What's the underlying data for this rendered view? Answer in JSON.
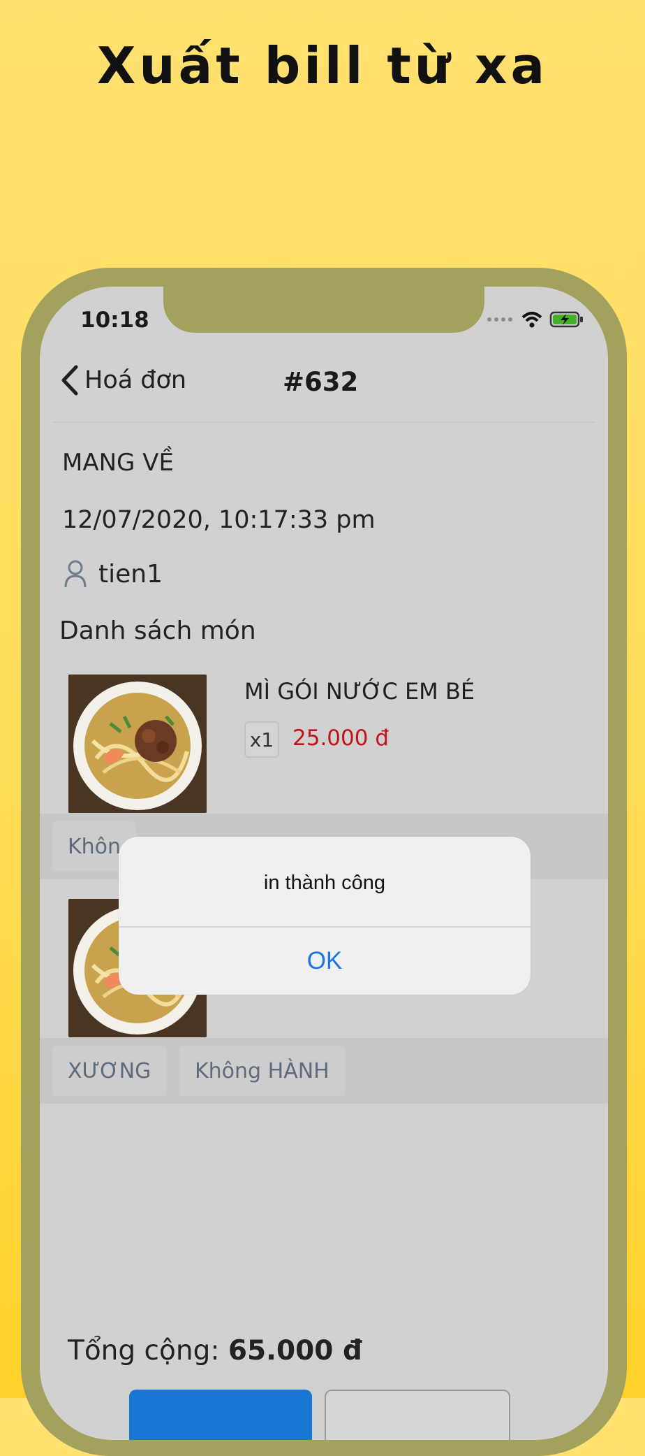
{
  "headline": "Xuất bill từ xa",
  "status_bar": {
    "time": "10:18"
  },
  "navbar": {
    "back_label": "Hoá đơn",
    "order_no": "#632"
  },
  "order": {
    "type": "MANG VỀ",
    "datetime": "12/07/2020, 10:17:33 pm",
    "staff": "tien1"
  },
  "section_title": "Danh sách món",
  "items": [
    {
      "name": "MÌ GÓI NƯỚC EM BÉ",
      "qty": "x1",
      "price": "25.000 đ",
      "tags": [
        "Khôn"
      ]
    },
    {
      "tags": [
        "XƯƠNG",
        "Không HÀNH"
      ]
    }
  ],
  "total": {
    "label": "Tổng cộng:",
    "value": "65.000 đ"
  },
  "alert": {
    "message": "in thành công",
    "ok_label": "OK"
  },
  "colors": {
    "accent": "#1976d2",
    "price": "#c0141a",
    "background": "#ffd84a"
  }
}
